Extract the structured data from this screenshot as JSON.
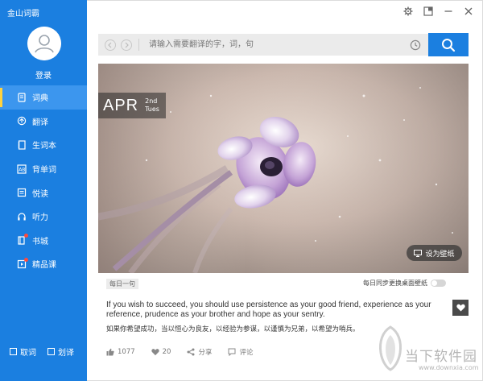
{
  "app": {
    "title": "金山词霸"
  },
  "user": {
    "login_label": "登录"
  },
  "sidebar": {
    "items": [
      {
        "label": "词典",
        "icon": "book-icon",
        "active": true
      },
      {
        "label": "翻译",
        "icon": "translate-icon",
        "active": false
      },
      {
        "label": "生词本",
        "icon": "notebook-icon",
        "active": false
      },
      {
        "label": "背单词",
        "icon": "flashcard-icon",
        "active": false
      },
      {
        "label": "悦读",
        "icon": "reading-icon",
        "active": false
      },
      {
        "label": "听力",
        "icon": "headphones-icon",
        "active": false
      },
      {
        "label": "书城",
        "icon": "bookstore-icon",
        "active": false,
        "badge": true
      },
      {
        "label": "精品课",
        "icon": "course-icon",
        "active": false,
        "badge": true
      }
    ],
    "footer": {
      "word_capture": "取词",
      "word_select": "划译"
    }
  },
  "search": {
    "placeholder": "请输入需要翻译的字，词，句"
  },
  "daily": {
    "month": "APR",
    "day": "2nd",
    "weekday": "Tues",
    "wallpaper_label": "设为壁纸",
    "tag": "每日一句",
    "sync_label": "每日同步更换桌面壁纸",
    "sentence_en": "If you wish to succeed, you should use persistence as your good friend, experience as your reference, prudence as your brother and hope as your sentry.",
    "sentence_zh": "如果你希望成功，当以恒心为良友，以经验为参谋，以谨慎为兄弟，以希望为哨兵。",
    "likes": "1077",
    "hearts": "20",
    "share_label": "分享",
    "comment_label": "评论"
  },
  "watermark": {
    "text": "当下软件园",
    "url": "www.downxia.com"
  },
  "colors": {
    "accent": "#1b7fe0",
    "active_item": "#3c96ee",
    "indicator": "#ffd23f",
    "badge": "#ff4a3d"
  }
}
